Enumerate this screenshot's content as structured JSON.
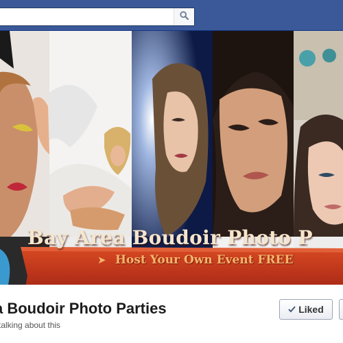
{
  "search": {
    "value": "",
    "placeholder": ""
  },
  "cover": {
    "banner_title": "Bay Area Boudoir Photo P",
    "banner_subtitle": "Host Your Own Event FREE",
    "panels": [
      "portrait-makeup",
      "woman-on-bed",
      "woman-backlit",
      "woman-closeup",
      "woman-smiling"
    ]
  },
  "page": {
    "name": "a Boudoir Photo Parties",
    "talking": "talking about this",
    "liked_label": "Liked"
  },
  "colors": {
    "topbar": "#3b5998",
    "banner_red": "#c0391a",
    "banner_text": "#f4e6ce",
    "banner_subtext": "#f7b46b"
  }
}
